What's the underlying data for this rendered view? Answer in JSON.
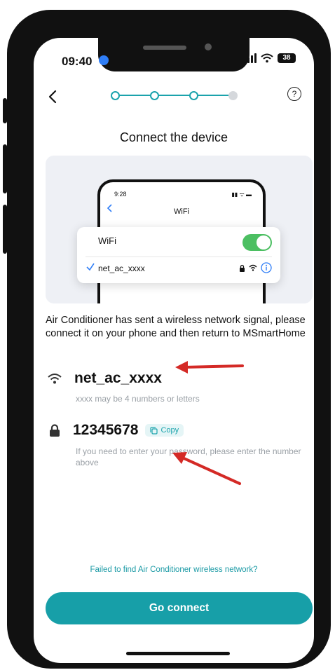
{
  "status_bar": {
    "time": "09:40",
    "battery": "38"
  },
  "header": {
    "help_label": "?"
  },
  "stepper": {
    "total_steps": 4,
    "completed_steps": 3,
    "active_color": "#1ba3ac"
  },
  "page_title": "Connect the device",
  "illustration": {
    "phone_time": "9:28",
    "screen_title": "WiFi",
    "wifi_label": "WiFi",
    "network_name": "net_ac_xxxx"
  },
  "description": "Air Conditioner has sent a wireless network signal, please connect it on your phone and then return to MSmartHome",
  "network": {
    "name": "net_ac_xxxx",
    "hint": "xxxx may be 4 numbers or letters"
  },
  "password": {
    "value": "12345678",
    "copy_label": "Copy",
    "hint": "If you need to enter your password, please enter the number above"
  },
  "failed_link": "Failed to find Air Conditioner wireless network?",
  "go_button": "Go connect",
  "colors": {
    "accent": "#179fa8",
    "annotation_arrow": "#d42a26"
  }
}
